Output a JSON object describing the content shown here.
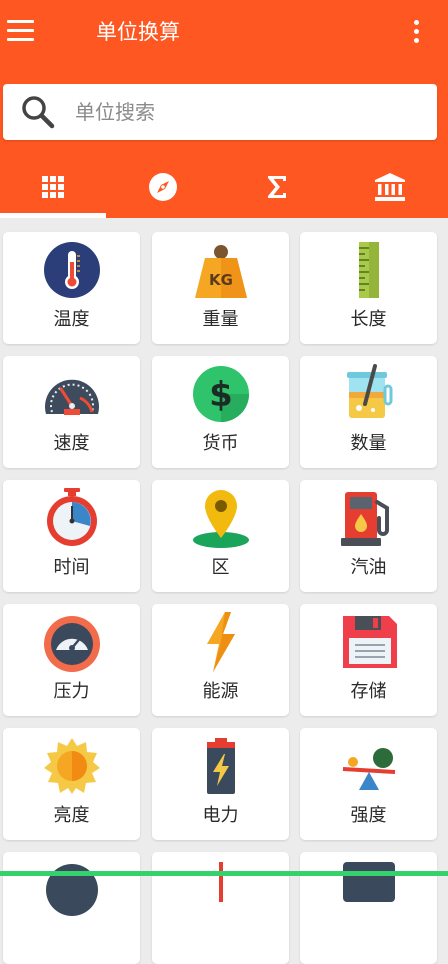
{
  "app": {
    "title": "单位换算"
  },
  "search": {
    "placeholder": "单位搜索"
  },
  "tabs": [
    {
      "icon": "grid-icon"
    },
    {
      "icon": "compass-icon"
    },
    {
      "icon": "sigma-icon"
    },
    {
      "icon": "bank-icon"
    }
  ],
  "units": [
    {
      "label": "温度",
      "icon": "thermometer-icon"
    },
    {
      "label": "重量",
      "icon": "kg-weight-icon"
    },
    {
      "label": "长度",
      "icon": "ruler-icon"
    },
    {
      "label": "速度",
      "icon": "speedometer-icon"
    },
    {
      "label": "货币",
      "icon": "dollar-coin-icon"
    },
    {
      "label": "数量",
      "icon": "beaker-icon"
    },
    {
      "label": "时间",
      "icon": "stopwatch-icon"
    },
    {
      "label": "区",
      "icon": "map-pin-icon"
    },
    {
      "label": "汽油",
      "icon": "fuel-pump-icon"
    },
    {
      "label": "压力",
      "icon": "pressure-gauge-icon"
    },
    {
      "label": "能源",
      "icon": "lightning-icon"
    },
    {
      "label": "存储",
      "icon": "floppy-disk-icon"
    },
    {
      "label": "亮度",
      "icon": "sun-icon"
    },
    {
      "label": "电力",
      "icon": "battery-icon"
    },
    {
      "label": "强度",
      "icon": "seesaw-icon"
    }
  ],
  "colors": {
    "primary": "#ff5722",
    "background": "#ececec",
    "card": "#ffffff"
  }
}
